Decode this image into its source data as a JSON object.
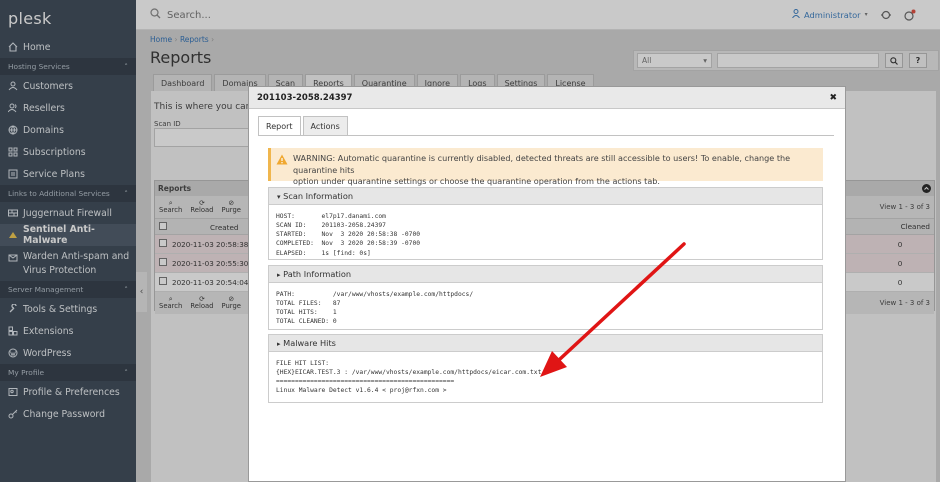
{
  "brand": "plesk",
  "sidebar": {
    "items": [
      {
        "label": "Home"
      },
      {
        "section": "Hosting Services"
      },
      {
        "label": "Customers"
      },
      {
        "label": "Resellers"
      },
      {
        "label": "Domains"
      },
      {
        "label": "Subscriptions"
      },
      {
        "label": "Service Plans"
      },
      {
        "section": "Links to Additional Services"
      },
      {
        "label": "Juggernaut Firewall"
      },
      {
        "label": "Sentinel Anti-Malware"
      },
      {
        "label": "Warden Anti-spam and",
        "label2": "Virus Protection"
      },
      {
        "section": "Server Management"
      },
      {
        "label": "Tools & Settings"
      },
      {
        "label": "Extensions"
      },
      {
        "label": "WordPress"
      },
      {
        "section": "My Profile"
      },
      {
        "label": "Profile & Preferences"
      },
      {
        "label": "Change Password"
      }
    ]
  },
  "topbar": {
    "search_placeholder": "Search...",
    "user": "Administrator"
  },
  "breadcrumb": {
    "home": "Home",
    "reports": "Reports"
  },
  "page": {
    "title": "Reports"
  },
  "filter": {
    "select_value": "All"
  },
  "tabs": [
    "Dashboard",
    "Domains",
    "Scan",
    "Reports",
    "Quarantine",
    "Ignore",
    "Logs",
    "Settings",
    "License"
  ],
  "content": {
    "intro": "This is where you can v",
    "scan_id_label": "Scan ID",
    "reports_label": "Reports",
    "tools": [
      "Search",
      "Reload",
      "Purge"
    ],
    "count": "View 1 - 3 of 3",
    "col_created": "Created",
    "col_cleaned": "Cleaned",
    "rows": [
      {
        "created": "2020-11-03 20:58:38",
        "cleaned": "0"
      },
      {
        "created": "2020-11-03 20:55:30",
        "cleaned": "0"
      },
      {
        "created": "2020-11-03 20:54:04",
        "cleaned": "0"
      }
    ]
  },
  "modal": {
    "title": "201103-2058.24397",
    "tabs": [
      "Report",
      "Actions"
    ],
    "warning_line1": "WARNING: Automatic quarantine is currently disabled, detected threats are still accessible to users! To enable, change the quarantine hits",
    "warning_line2": "option under quarantine settings or choose the quarantine operation from the actions tab.",
    "scan_info_title": "Scan Information",
    "scan_info": "HOST:       el7p17.danami.com\nSCAN ID:    201103-2058.24397\nSTARTED:    Nov  3 2020 20:58:38 -0700\nCOMPLETED:  Nov  3 2020 20:58:39 -0700\nELAPSED:    1s [find: 0s]",
    "path_info_title": "Path Information",
    "path_info": "PATH:          /var/www/vhosts/example.com/httpdocs/\nTOTAL FILES:   87\nTOTAL HITS:    1\nTOTAL CLEANED: 0",
    "malware_title": "Malware Hits",
    "malware": "FILE HIT LIST:\n{HEX}EICAR.TEST.3 : /var/www/vhosts/example.com/httpdocs/eicar.com.txt\n===============================================\nLinux Malware Detect v1.6.4 < proj@rfxn.com >"
  },
  "colors": {
    "sidebar": "#3a4756",
    "accent": "#2d71b8",
    "arrow": "#e01515",
    "warning_bg": "#fbead0"
  }
}
